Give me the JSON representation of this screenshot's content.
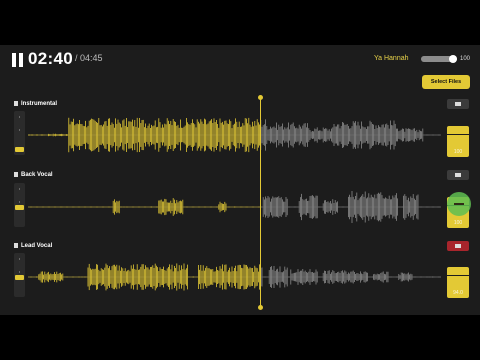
{
  "player": {
    "current_time": "02:40",
    "total_time": "/ 04:45",
    "state": "paused"
  },
  "header": {
    "song_title": "Ya Hannah",
    "volume": 100,
    "volume_label": "100",
    "select_files_label": "Select Files"
  },
  "playback_progress": 0.56,
  "colors": {
    "accent": "#e3c935",
    "played": "#e3c935",
    "unplayed": "#8a8a8a",
    "muted": "#a8252c",
    "pan": "#5fbf52"
  },
  "tracks": [
    {
      "name": "Instrumental",
      "mute_icon": "speaker-icon",
      "muted": false,
      "meter_label": "100"
    },
    {
      "name": "Back Vocal",
      "mute_icon": "speaker-icon",
      "muted": false,
      "meter_label": "100"
    },
    {
      "name": "Lead Vocal",
      "mute_icon": "speaker-muted-icon",
      "muted": true,
      "meter_label": "94.0"
    }
  ]
}
